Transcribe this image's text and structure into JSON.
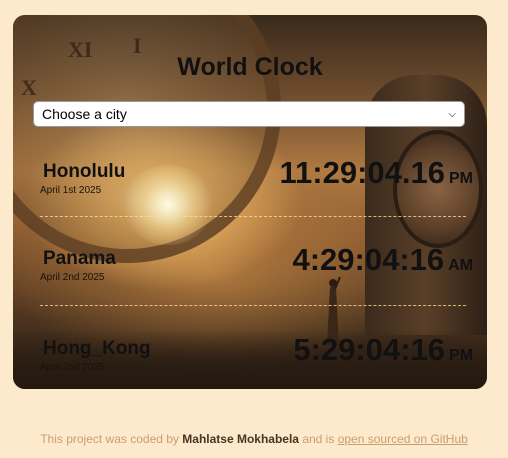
{
  "app": {
    "title": "World Clock"
  },
  "select": {
    "value": "Choose a city"
  },
  "cities": [
    {
      "name": "Honolulu",
      "date": "April 1st 2025",
      "time": "11:29:04.16",
      "ampm": "PM"
    },
    {
      "name": "Panama",
      "date": "April 2nd 2025",
      "time": "4:29:04:16",
      "ampm": "AM"
    },
    {
      "name": "Hong_Kong",
      "date": "April 2nd 2025",
      "time": "5:29:04:16",
      "ampm": "PM"
    }
  ],
  "footer": {
    "prefix": "This project was coded by",
    "author": "Mahlatse Mokhabela",
    "middle": "and is",
    "link": "open sourced on GitHub"
  },
  "colors": {
    "page_bg": "#fde9cc",
    "footer_text": "#c8a070"
  }
}
